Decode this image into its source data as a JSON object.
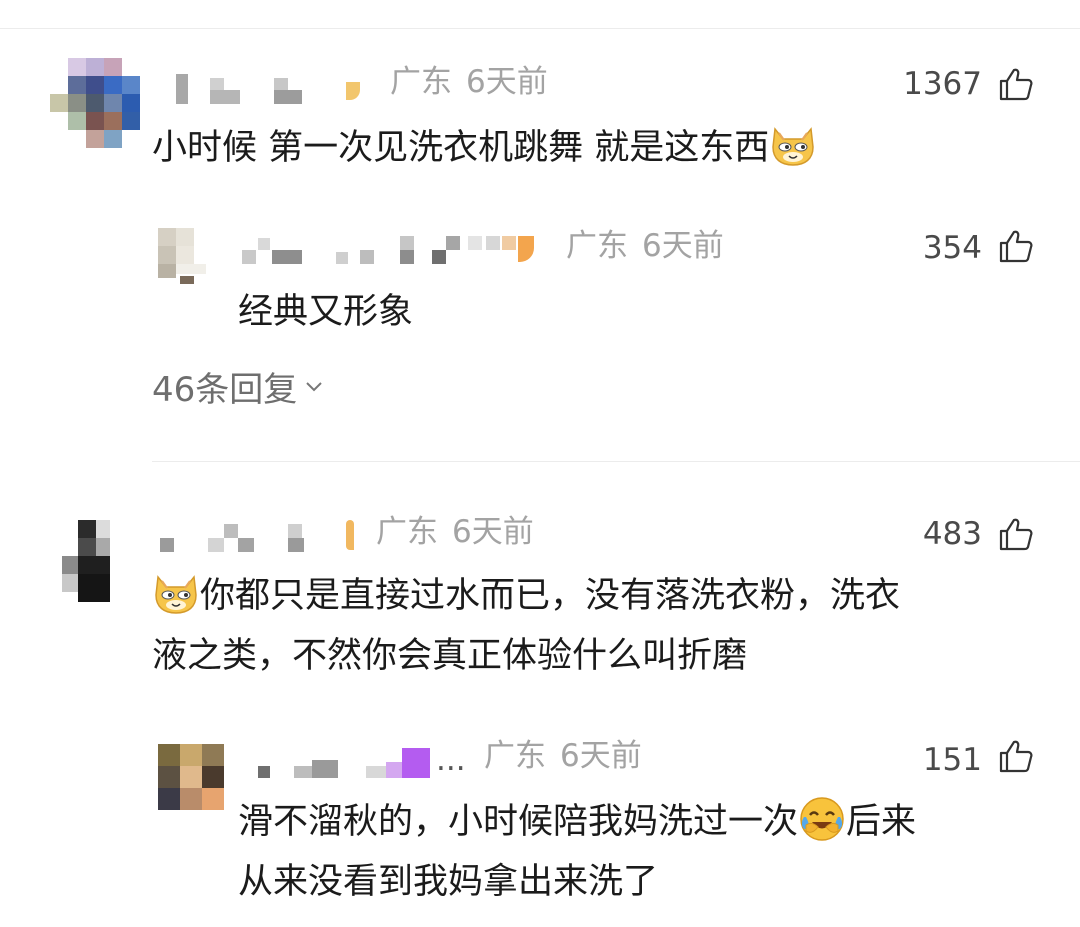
{
  "comments": [
    {
      "location": "广东",
      "time": "6天前",
      "likes": "1367",
      "text": "小时候 第一次见洗衣机跳舞 就是这东西",
      "text_emoji": "doge-cat-emoji",
      "replies": [
        {
          "location": "广东",
          "time": "6天前",
          "likes": "354",
          "text": "经典又形象"
        }
      ],
      "reply_count_label": "46条回复"
    },
    {
      "location": "广东",
      "time": "6天前",
      "likes": "483",
      "text_emoji": "doge-cat-emoji",
      "text_line1": "你都只是直接过水而已，没有落洗衣粉，洗衣",
      "text_line2": "液之类，不然你会真正体验什么叫折磨",
      "replies": [
        {
          "name_suffix": "...",
          "location": "广东",
          "time": "6天前",
          "likes": "151",
          "text_line1_a": "滑不溜秋的，小时候陪我妈洗过一次",
          "text_emoji": "laugh-cry-emoji",
          "text_line1_b": "后来",
          "text_line2": "从来没看到我妈拿出来洗了"
        }
      ]
    }
  ],
  "icons": {
    "like": "thumbs-up-icon",
    "expand": "chevron-down-icon"
  },
  "colors": {
    "meta": "#a3a3a3",
    "text": "#1b1b1b",
    "divider": "#ececec",
    "emoji_yellow": "#f6c54a"
  }
}
